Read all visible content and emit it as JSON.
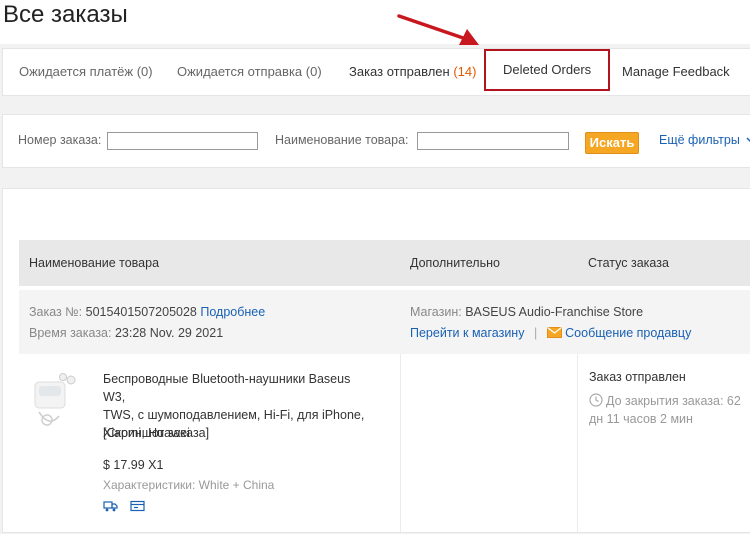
{
  "page": {
    "title": "Все заказы"
  },
  "tabs": [
    {
      "label": "Ожидается платёж (0)"
    },
    {
      "label": "Ожидается отправка (0)"
    },
    {
      "label": "Заказ отправлен",
      "count": "(14)"
    },
    {
      "label": "Deleted Orders"
    },
    {
      "label": "Manage Feedback"
    }
  ],
  "filters": {
    "order_number_label": "Номер заказа:",
    "product_name_label": "Наименование товара:",
    "search_button": "Искать",
    "more_filters": "Ещё фильтры"
  },
  "table": {
    "headers": [
      "Наименование товара",
      "Дополнительно",
      "Статус заказа"
    ]
  },
  "order": {
    "number_label": "Заказ №:",
    "number": "5015401507205028",
    "details_link": "Подробнее",
    "time_label": "Время заказа:",
    "time": "23:28 Nov. 29 2021",
    "store_label": "Магазин:",
    "store_name": "BASEUS Audio-Franchise Store",
    "go_to_store": "Перейти к магазину",
    "separator": "|",
    "message_seller": "Сообщение продавцу",
    "item": {
      "name_lines": [
        "Беспроводные Bluetooth-наушники Baseus W3,",
        "TWS, с шумоподавлением, Hi-Fi, для iPhone,",
        "Xiaomi, Huawei"
      ],
      "snapshot": "[Скриншот заказа]",
      "price": "$ 17.99 X1",
      "props_label": "Характеристики:",
      "props_value": "White + China"
    },
    "status": "Заказ отправлен",
    "closing_line1": "До закрытия заказа: 62",
    "closing_line2": "дн 11 часов 2 мин"
  },
  "colors": {
    "accent": "#f5a623",
    "link": "#1a61b3",
    "highlight_border": "#b3131d"
  },
  "icons": [
    "arrow-annotation-icon",
    "chevron-down-icon",
    "envelope-icon",
    "clock-icon",
    "truck-icon",
    "card-icon"
  ]
}
